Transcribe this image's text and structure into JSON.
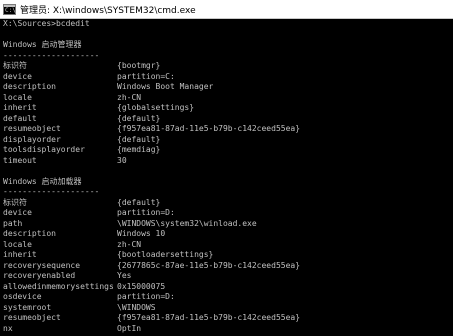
{
  "titlebar": {
    "icon_label": "C:\\",
    "title": "管理员: X:\\windows\\SYSTEM32\\cmd.exe"
  },
  "console": {
    "prompt": "X:\\Sources>bcdedit",
    "section1": {
      "heading": "Windows 启动管理器",
      "separator": "--------------------",
      "rows": [
        {
          "key": "标识符",
          "value": "{bootmgr}"
        },
        {
          "key": "device",
          "value": "partition=C:"
        },
        {
          "key": "description",
          "value": "Windows Boot Manager"
        },
        {
          "key": "locale",
          "value": "zh-CN"
        },
        {
          "key": "inherit",
          "value": "{globalsettings}"
        },
        {
          "key": "default",
          "value": "{default}"
        },
        {
          "key": "resumeobject",
          "value": "{f957ea81-87ad-11e5-b79b-c142ceed55ea}"
        },
        {
          "key": "displayorder",
          "value": "{default}"
        },
        {
          "key": "toolsdisplayorder",
          "value": "{memdiag}"
        },
        {
          "key": "timeout",
          "value": "30"
        }
      ]
    },
    "section2": {
      "heading": "Windows 启动加载器",
      "separator": "--------------------",
      "rows": [
        {
          "key": "标识符",
          "value": "{default}"
        },
        {
          "key": "device",
          "value": "partition=D:"
        },
        {
          "key": "path",
          "value": "\\WINDOWS\\system32\\winload.exe"
        },
        {
          "key": "description",
          "value": "Windows 10"
        },
        {
          "key": "locale",
          "value": "zh-CN"
        },
        {
          "key": "inherit",
          "value": "{bootloadersettings}"
        },
        {
          "key": "recoverysequence",
          "value": "{2677865c-87ae-11e5-b79b-c142ceed55ea}"
        },
        {
          "key": "recoveryenabled",
          "value": "Yes"
        },
        {
          "key": "allowedinmemorysettings",
          "value": "0x15000075"
        },
        {
          "key": "osdevice",
          "value": "partition=D:"
        },
        {
          "key": "systemroot",
          "value": "\\WINDOWS"
        },
        {
          "key": "resumeobject",
          "value": "{f957ea81-87ad-11e5-b79b-c142ceed55ea}"
        },
        {
          "key": "nx",
          "value": "OptIn"
        }
      ]
    }
  },
  "colors": {
    "console_background": "#000000",
    "console_text": "#c0c0c0",
    "titlebar_background": "#ffffff"
  }
}
